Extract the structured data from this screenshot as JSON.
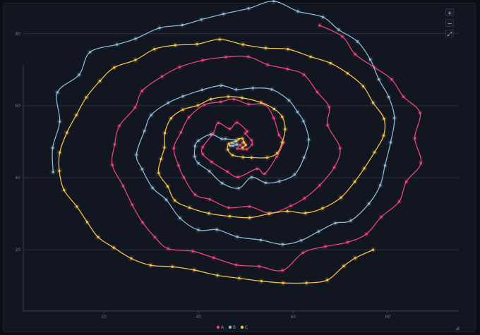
{
  "controls": {
    "zoom_in": "+",
    "zoom_out": "−",
    "fullscreen": "⤢",
    "resize": "◢"
  },
  "chart_data": {
    "type": "line",
    "title": "",
    "xlabel": "",
    "ylabel": "",
    "xlim": [
      3,
      95
    ],
    "ylim": [
      3,
      87
    ],
    "xticks": [
      20,
      40,
      60,
      80
    ],
    "yticks": [
      20,
      40,
      60,
      80
    ],
    "grid": {
      "horizontal": true,
      "vertical": false
    },
    "legend": {
      "position": "bottom-center"
    },
    "series": [
      {
        "name": "A",
        "color": "#e8457f",
        "points": [
          [
            65.6,
            82.3
          ],
          [
            70.4,
            79.2
          ],
          [
            73.1,
            74.3
          ],
          [
            77.1,
            70.7
          ],
          [
            80.8,
            67.3
          ],
          [
            83.3,
            62.5
          ],
          [
            86.8,
            58.0
          ],
          [
            85.7,
            51.0
          ],
          [
            87.0,
            44.1
          ],
          [
            83.9,
            38.9
          ],
          [
            82.4,
            33.4
          ],
          [
            78.6,
            29.1
          ],
          [
            75.5,
            24.4
          ],
          [
            71.5,
            22.1
          ],
          [
            66.8,
            20.9
          ],
          [
            62.1,
            19.2
          ],
          [
            57.8,
            14.3
          ],
          [
            52.8,
            15.4
          ],
          [
            48.0,
            15.8
          ],
          [
            43.2,
            17.8
          ],
          [
            38.8,
            19.6
          ],
          [
            33.6,
            20.3
          ],
          [
            30.8,
            23.5
          ],
          [
            28.2,
            27.6
          ],
          [
            26.0,
            32.5
          ],
          [
            24.1,
            37.7
          ],
          [
            21.8,
            43.6
          ],
          [
            22.3,
            49.2
          ],
          [
            23.3,
            54.4
          ],
          [
            26.6,
            59.5
          ],
          [
            28.1,
            64.1
          ],
          [
            32.3,
            68.1
          ],
          [
            36.0,
            70.7
          ],
          [
            40.9,
            72.6
          ],
          [
            45.8,
            73.5
          ],
          [
            50.5,
            73.6
          ],
          [
            54.6,
            71.4
          ],
          [
            58.8,
            70.2
          ],
          [
            62.3,
            68.6
          ],
          [
            65.1,
            63.8
          ],
          [
            67.6,
            59.6
          ],
          [
            67.3,
            54.6
          ],
          [
            69.9,
            48.2
          ],
          [
            68.7,
            42.9
          ],
          [
            65.6,
            37.9
          ],
          [
            62.4,
            34.3
          ],
          [
            59.5,
            32.2
          ],
          [
            55.2,
            30.2
          ],
          [
            50.8,
            32.0
          ],
          [
            46.4,
            31.7
          ],
          [
            42.4,
            34.0
          ],
          [
            39.3,
            35.3
          ],
          [
            36.9,
            40.1
          ],
          [
            35.8,
            43.4
          ],
          [
            34.8,
            48.2
          ],
          [
            36.3,
            52.6
          ],
          [
            38.0,
            56.8
          ],
          [
            41.2,
            60.2
          ],
          [
            44.7,
            61.1
          ],
          [
            47.5,
            61.8
          ],
          [
            50.6,
            60.4
          ],
          [
            54.0,
            60.3
          ],
          [
            55.9,
            56.6
          ],
          [
            57.0,
            51.9
          ],
          [
            57.9,
            49.8
          ],
          [
            56.5,
            45.8
          ],
          [
            54.0,
            41.1
          ],
          [
            52.4,
            42.5
          ],
          [
            48.4,
            40.2
          ],
          [
            46.1,
            41.7
          ],
          [
            42.8,
            44.4
          ],
          [
            40.9,
            46.6
          ],
          [
            40.9,
            48.5
          ],
          [
            43.1,
            52.3
          ],
          [
            44.2,
            55.2
          ],
          [
            46.6,
            53.6
          ],
          [
            48.1,
            55.3
          ],
          [
            50.3,
            52.9
          ],
          [
            49.9,
            52.3
          ],
          [
            51.2,
            50.4
          ],
          [
            51.3,
            49.2
          ],
          [
            50.2,
            47.9
          ],
          [
            49.4,
            48.0
          ],
          [
            48.2,
            48.1
          ],
          [
            48.8,
            49.1
          ],
          [
            49.4,
            49.8
          ]
        ]
      },
      {
        "name": "B",
        "color": "#8cb8d8",
        "points": [
          [
            9.3,
            41.6
          ],
          [
            9.2,
            48.3
          ],
          [
            10.7,
            55.6
          ],
          [
            10.2,
            63.7
          ],
          [
            14.8,
            68.6
          ],
          [
            17.1,
            74.9
          ],
          [
            22.8,
            77.0
          ],
          [
            26.7,
            78.6
          ],
          [
            31.8,
            81.6
          ],
          [
            36.6,
            82.4
          ],
          [
            40.6,
            83.9
          ],
          [
            45.3,
            85.5
          ],
          [
            50.6,
            87.0
          ],
          [
            55.9,
            89.0
          ],
          [
            61.0,
            86.2
          ],
          [
            66.3,
            84.6
          ],
          [
            69.6,
            81.1
          ],
          [
            73.6,
            77.8
          ],
          [
            76.3,
            72.8
          ],
          [
            78.1,
            67.3
          ],
          [
            80.2,
            62.4
          ],
          [
            81.4,
            56.6
          ],
          [
            80.6,
            49.8
          ],
          [
            79.4,
            43.4
          ],
          [
            78.4,
            37.9
          ],
          [
            76.0,
            32.8
          ],
          [
            72.2,
            28.1
          ],
          [
            68.9,
            27.4
          ],
          [
            65.4,
            25.1
          ],
          [
            61.7,
            22.6
          ],
          [
            57.8,
            21.5
          ],
          [
            53.2,
            22.7
          ],
          [
            48.2,
            23.6
          ],
          [
            43.9,
            25.6
          ],
          [
            40.0,
            25.5
          ],
          [
            36.1,
            28.8
          ],
          [
            33.2,
            33.9
          ],
          [
            30.3,
            37.2
          ],
          [
            28.1,
            42.4
          ],
          [
            26.9,
            46.4
          ],
          [
            28.6,
            53.0
          ],
          [
            30.0,
            57.4
          ],
          [
            33.6,
            60.8
          ],
          [
            36.7,
            62.6
          ],
          [
            40.8,
            64.4
          ],
          [
            44.8,
            65.6
          ],
          [
            48.0,
            64.5
          ],
          [
            51.5,
            64.9
          ],
          [
            55.5,
            64.5
          ],
          [
            59.1,
            61.5
          ],
          [
            60.9,
            58.3
          ],
          [
            62.2,
            55.7
          ],
          [
            63.3,
            50.6
          ],
          [
            62.3,
            45.6
          ],
          [
            60.3,
            40.9
          ],
          [
            57.1,
            39.0
          ],
          [
            54.2,
            38.6
          ],
          [
            51.2,
            40.1
          ],
          [
            48.5,
            37.1
          ],
          [
            45.0,
            38.5
          ],
          [
            42.3,
            41.8
          ],
          [
            40.0,
            44.0
          ],
          [
            39.2,
            45.9
          ],
          [
            39.3,
            48.8
          ],
          [
            40.0,
            50.3
          ],
          [
            42.6,
            52.0
          ],
          [
            44.9,
            50.8
          ],
          [
            45.7,
            50.8
          ],
          [
            47.9,
            50.4
          ],
          [
            47.0,
            49.7
          ],
          [
            48.2,
            49.2
          ],
          [
            47.3,
            48.9
          ],
          [
            46.7,
            48.9
          ]
        ]
      },
      {
        "name": "C",
        "color": "#f2c14e",
        "points": [
          [
            76.9,
            20.0
          ],
          [
            73.1,
            17.7
          ],
          [
            70.7,
            15.5
          ],
          [
            67.2,
            11.6
          ],
          [
            62.8,
            10.8
          ],
          [
            57.9,
            10.8
          ],
          [
            53.3,
            11.3
          ],
          [
            48.6,
            12.1
          ],
          [
            44.0,
            12.9
          ],
          [
            39.1,
            14.4
          ],
          [
            34.5,
            15.3
          ],
          [
            29.9,
            15.7
          ],
          [
            25.8,
            17.6
          ],
          [
            22.1,
            20.6
          ],
          [
            18.8,
            23.5
          ],
          [
            16.5,
            27.7
          ],
          [
            14.3,
            32.0
          ],
          [
            11.6,
            36.6
          ],
          [
            10.6,
            41.9
          ],
          [
            10.7,
            47.0
          ],
          [
            12.2,
            52.5
          ],
          [
            14.2,
            57.4
          ],
          [
            16.3,
            62.3
          ],
          [
            19.2,
            66.9
          ],
          [
            22.2,
            70.6
          ],
          [
            26.7,
            72.7
          ],
          [
            30.7,
            75.7
          ],
          [
            35.1,
            76.8
          ],
          [
            39.7,
            77.1
          ],
          [
            44.5,
            78.4
          ],
          [
            49.4,
            77.0
          ],
          [
            54.2,
            76.0
          ],
          [
            58.9,
            75.7
          ],
          [
            63.7,
            73.6
          ],
          [
            67.9,
            71.8
          ],
          [
            71.5,
            69.0
          ],
          [
            74.8,
            65.4
          ],
          [
            76.9,
            60.8
          ],
          [
            79.2,
            56.4
          ],
          [
            79.1,
            51.7
          ],
          [
            77.2,
            47.1
          ],
          [
            75.0,
            42.6
          ],
          [
            73.0,
            38.9
          ],
          [
            70.1,
            34.5
          ],
          [
            66.2,
            31.5
          ],
          [
            62.6,
            30.2
          ],
          [
            58.8,
            30.7
          ],
          [
            54.9,
            30.0
          ],
          [
            50.8,
            28.9
          ],
          [
            46.6,
            29.3
          ],
          [
            42.2,
            30.1
          ],
          [
            38.1,
            31.7
          ],
          [
            35.0,
            33.7
          ],
          [
            33.5,
            37.6
          ],
          [
            31.6,
            41.3
          ],
          [
            32.1,
            45.2
          ],
          [
            32.8,
            48.4
          ],
          [
            32.9,
            52.4
          ],
          [
            34.2,
            56.5
          ],
          [
            36.7,
            58.9
          ],
          [
            39.9,
            60.1
          ],
          [
            42.6,
            61.8
          ],
          [
            46.3,
            62.5
          ],
          [
            49.2,
            62.2
          ],
          [
            53.2,
            60.9
          ],
          [
            56.0,
            59.1
          ],
          [
            57.7,
            56.9
          ],
          [
            58.3,
            53.5
          ],
          [
            57.7,
            49.8
          ],
          [
            56.6,
            46.8
          ],
          [
            54.5,
            45.6
          ],
          [
            51.2,
            45.6
          ],
          [
            49.4,
            45.7
          ],
          [
            47.2,
            46.3
          ],
          [
            46.2,
            47.8
          ],
          [
            46.4,
            49.4
          ],
          [
            48.0,
            50.1
          ],
          [
            48.5,
            50.7
          ],
          [
            49.3,
            50.9
          ],
          [
            49.6,
            49.8
          ],
          [
            50.0,
            49.1
          ],
          [
            49.3,
            48.4
          ]
        ]
      }
    ]
  }
}
